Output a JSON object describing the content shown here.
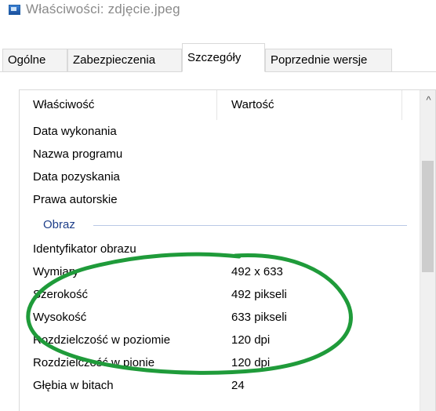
{
  "window": {
    "title": "Właściwości: zdjęcie.jpeg"
  },
  "tabs": [
    {
      "label": "Ogólne"
    },
    {
      "label": "Zabezpieczenia"
    },
    {
      "label": "Szczegóły"
    },
    {
      "label": "Poprzednie wersje"
    }
  ],
  "active_tab": "Szczegóły",
  "columns": {
    "property": "Właściwość",
    "value": "Wartość"
  },
  "rows_top": [
    {
      "name": "Data wykonania",
      "value": ""
    },
    {
      "name": "Nazwa programu",
      "value": ""
    },
    {
      "name": "Data pozyskania",
      "value": ""
    },
    {
      "name": "Prawa autorskie",
      "value": ""
    }
  ],
  "group": {
    "title": "Obraz"
  },
  "rows_image": [
    {
      "name": "Identyfikator obrazu",
      "value": ""
    },
    {
      "name": "Wymiary",
      "value": "492 x 633"
    },
    {
      "name": "Szerokość",
      "value": "492 pikseli"
    },
    {
      "name": "Wysokość",
      "value": "633 pikseli"
    },
    {
      "name": "Rozdzielczość w poziomie",
      "value": "120 dpi"
    },
    {
      "name": "Rozdzielczość w pionie",
      "value": "120 dpi"
    },
    {
      "name": "Głębia w bitach",
      "value": "24"
    }
  ],
  "scrollbar": {
    "up_arrow": "^"
  },
  "colors": {
    "annotation": "#1f9b3a",
    "group_title": "#1e3f8a"
  }
}
